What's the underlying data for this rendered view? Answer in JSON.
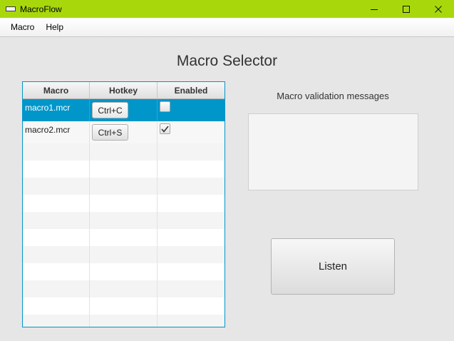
{
  "window": {
    "title": "MacroFlow",
    "icon": "app-window-icon",
    "controls": [
      "minimize-icon",
      "maximize-icon",
      "close-icon"
    ]
  },
  "menu": {
    "items": [
      "Macro",
      "Help"
    ]
  },
  "page": {
    "title": "Macro Selector"
  },
  "table": {
    "columns": [
      "Macro",
      "Hotkey",
      "Enabled"
    ],
    "rows": [
      {
        "macro": "macro1.mcr",
        "hotkey": "Ctrl+C",
        "enabled": false,
        "selected": true
      },
      {
        "macro": "macro2.mcr",
        "hotkey": "Ctrl+S",
        "enabled": true,
        "selected": false
      }
    ]
  },
  "validation": {
    "label": "Macro validation messages",
    "messages": ""
  },
  "actions": {
    "listen_label": "Listen"
  },
  "colors": {
    "titlebar": "#a8d80c",
    "selection": "#0096c9",
    "background": "#e6e6e6"
  }
}
